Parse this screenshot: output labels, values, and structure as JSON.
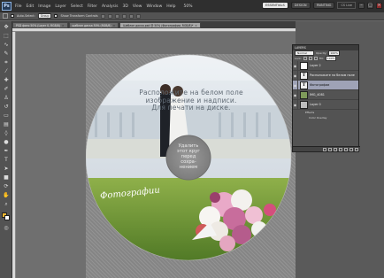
{
  "menu": {
    "logo": "Ps",
    "items": [
      "File",
      "Edit",
      "Image",
      "Layer",
      "Select",
      "Filter",
      "Analysis",
      "3D",
      "View",
      "Window",
      "Help"
    ],
    "mode_buttons": [
      "ESSENTIALS",
      "DESIGN",
      "PAINTING"
    ],
    "active_mode": "ESSENTIALS",
    "cs_live": "CS Live",
    "zoom": "50%"
  },
  "options": {
    "auto_select": "Auto-Select:",
    "group": "Group",
    "show_transform": "Show Transform Controls"
  },
  "tabs": [
    {
      "label": "PSD фото 50% (Layer 0, RGB/8)"
    },
    {
      "label": "шаблон диска 50% (RGB/8)"
    },
    {
      "label": "Шаблон диска.psd @ 50% (Фотографии, RGB/8)*"
    }
  ],
  "disc": {
    "instruction": "Расположите на белом поле изображение и надписи. Для печати на диске.",
    "hole_text": "Удалить этот круг перед сохра-нением",
    "photo_caption": "Фотографии"
  },
  "layers_panel": {
    "title": "LAYERS",
    "blend_mode": "Normal",
    "opacity_label": "Opacity:",
    "opacity": "100%",
    "lock_label": "Lock:",
    "fill_label": "Fill:",
    "fill": "100%",
    "layers": [
      {
        "name": "Layer 2",
        "thumb": "",
        "selected": false
      },
      {
        "name": "Расположите на белом поле",
        "thumb": "T",
        "selected": false
      },
      {
        "name": "Фотографии",
        "thumb": "T",
        "selected": true
      },
      {
        "name": "IMG_4081",
        "thumb": "",
        "selected": false
      },
      {
        "name": "Layer 0",
        "thumb": "",
        "selected": false
      }
    ],
    "effects_label": "Effects",
    "color_overlay": "Color Overlay"
  },
  "colors": {
    "menu_bg": "#2f2f2f",
    "selected_layer": "#9ea2b6",
    "canvas_bg": "#6f6f6f"
  }
}
